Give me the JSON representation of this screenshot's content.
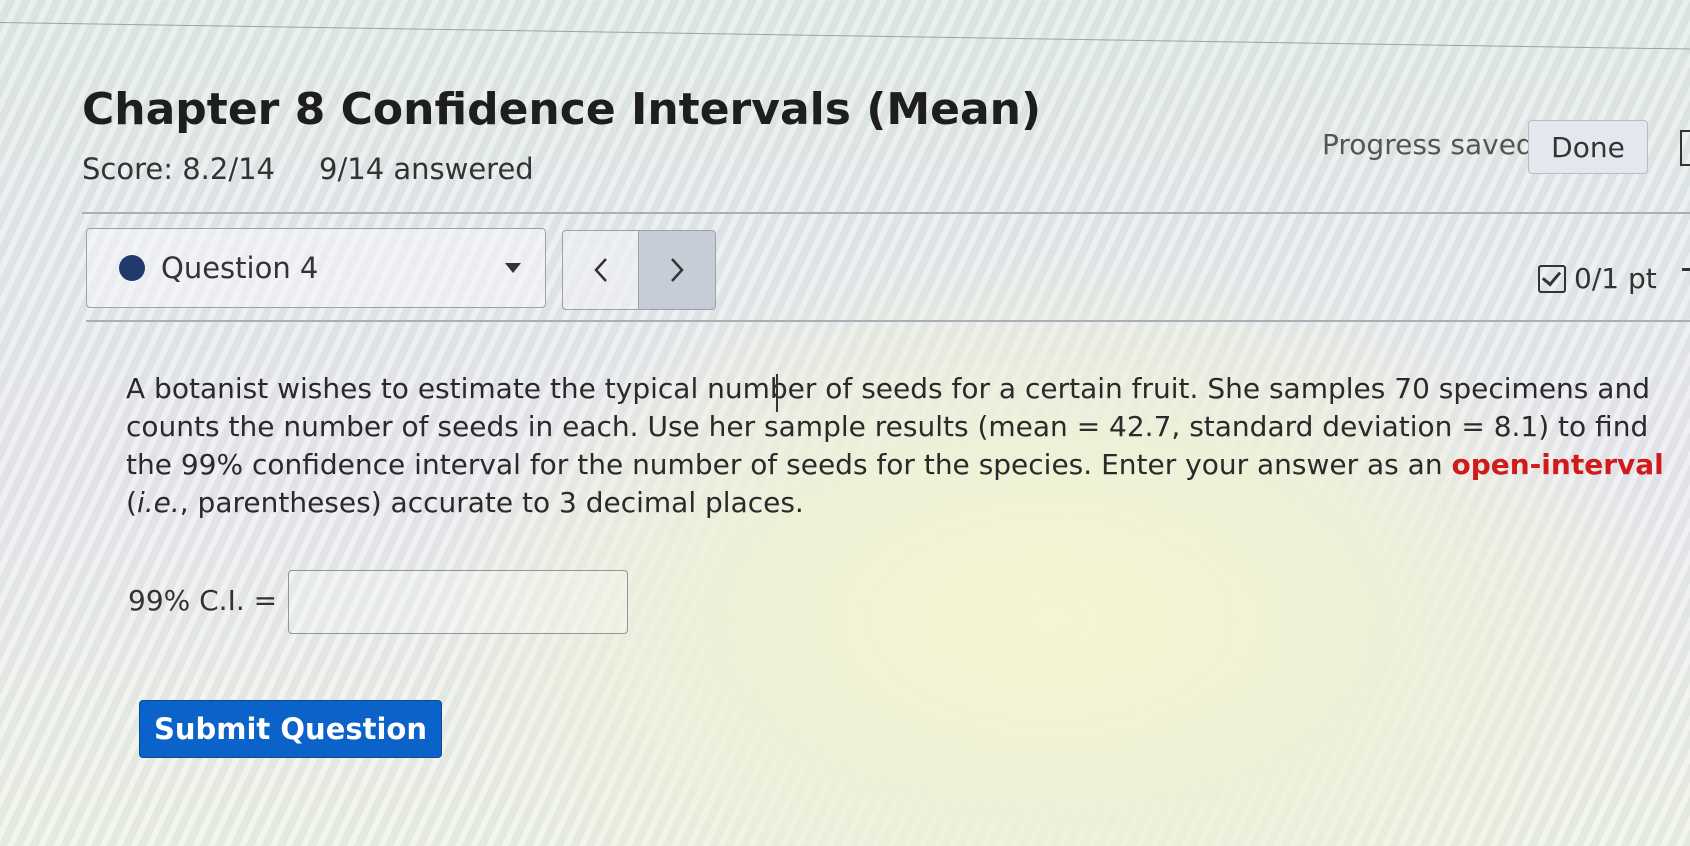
{
  "assignment": {
    "title": "Chapter 8 Confidence Intervals (Mean)",
    "score": "Score: 8.2/14",
    "answered": "9/14 answered"
  },
  "header": {
    "progress_status": "Progress saved",
    "done_label": "Done"
  },
  "question_nav": {
    "current_label": "Question 4",
    "prev_icon": "chevron-left-icon",
    "next_icon": "chevron-right-icon",
    "points": "0/1 pt"
  },
  "question": {
    "line1": "A botanist wishes to estimate the typical number of seeds for a certain fruit. She samples 70 specimens and",
    "line2": "counts the number of seeds in each. Use her sample results (mean = 42.7, standard deviation = 8.1) to find",
    "line3_start": "the 99% confidence interval for the number of seeds for the species. Enter your answer as an ",
    "line3_highlight": "open-interval",
    "line4_ie": "i.e.",
    "line4_rest": ", parentheses) accurate to 3 decimal places."
  },
  "answer": {
    "label": "99% C.I. =",
    "value": ""
  },
  "actions": {
    "submit_label": "Submit Question"
  },
  "colors": {
    "primary_button": "#0b63c9",
    "highlight_text": "#d11a1a",
    "status_dot": "#1f3a6b"
  }
}
